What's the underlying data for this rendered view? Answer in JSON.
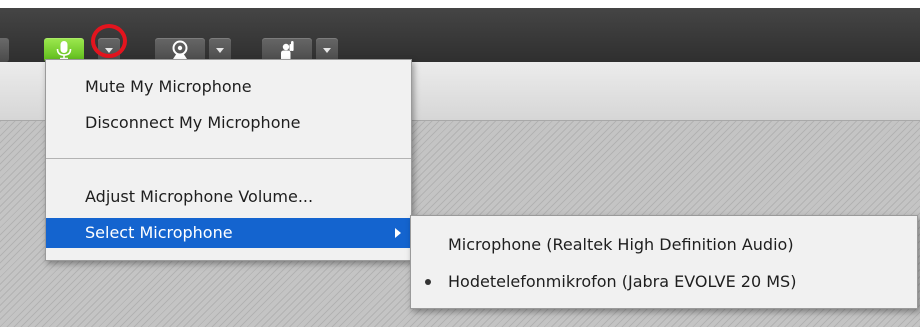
{
  "toolbar": {
    "buttons": [
      {
        "icon": "microphone-icon",
        "state": "active",
        "color": "#5cbb18"
      },
      {
        "icon": "webcam-icon",
        "state": "normal"
      },
      {
        "icon": "raise-hand-icon",
        "state": "normal"
      }
    ],
    "annotation_color": "#e3141e"
  },
  "microphone_menu": {
    "items": [
      {
        "label": "Mute My Microphone"
      },
      {
        "label": "Disconnect My Microphone"
      },
      {
        "label": "Adjust Microphone Volume..."
      },
      {
        "label": "Select Microphone",
        "selected": true,
        "has_submenu": true
      }
    ],
    "selection_color": "#1464cf"
  },
  "select_microphone_submenu": {
    "options": [
      {
        "label": "Microphone (Realtek High Definition Audio)",
        "checked": false
      },
      {
        "label": "Hodetelefonmikrofon (Jabra EVOLVE 20 MS)",
        "checked": true
      }
    ]
  }
}
